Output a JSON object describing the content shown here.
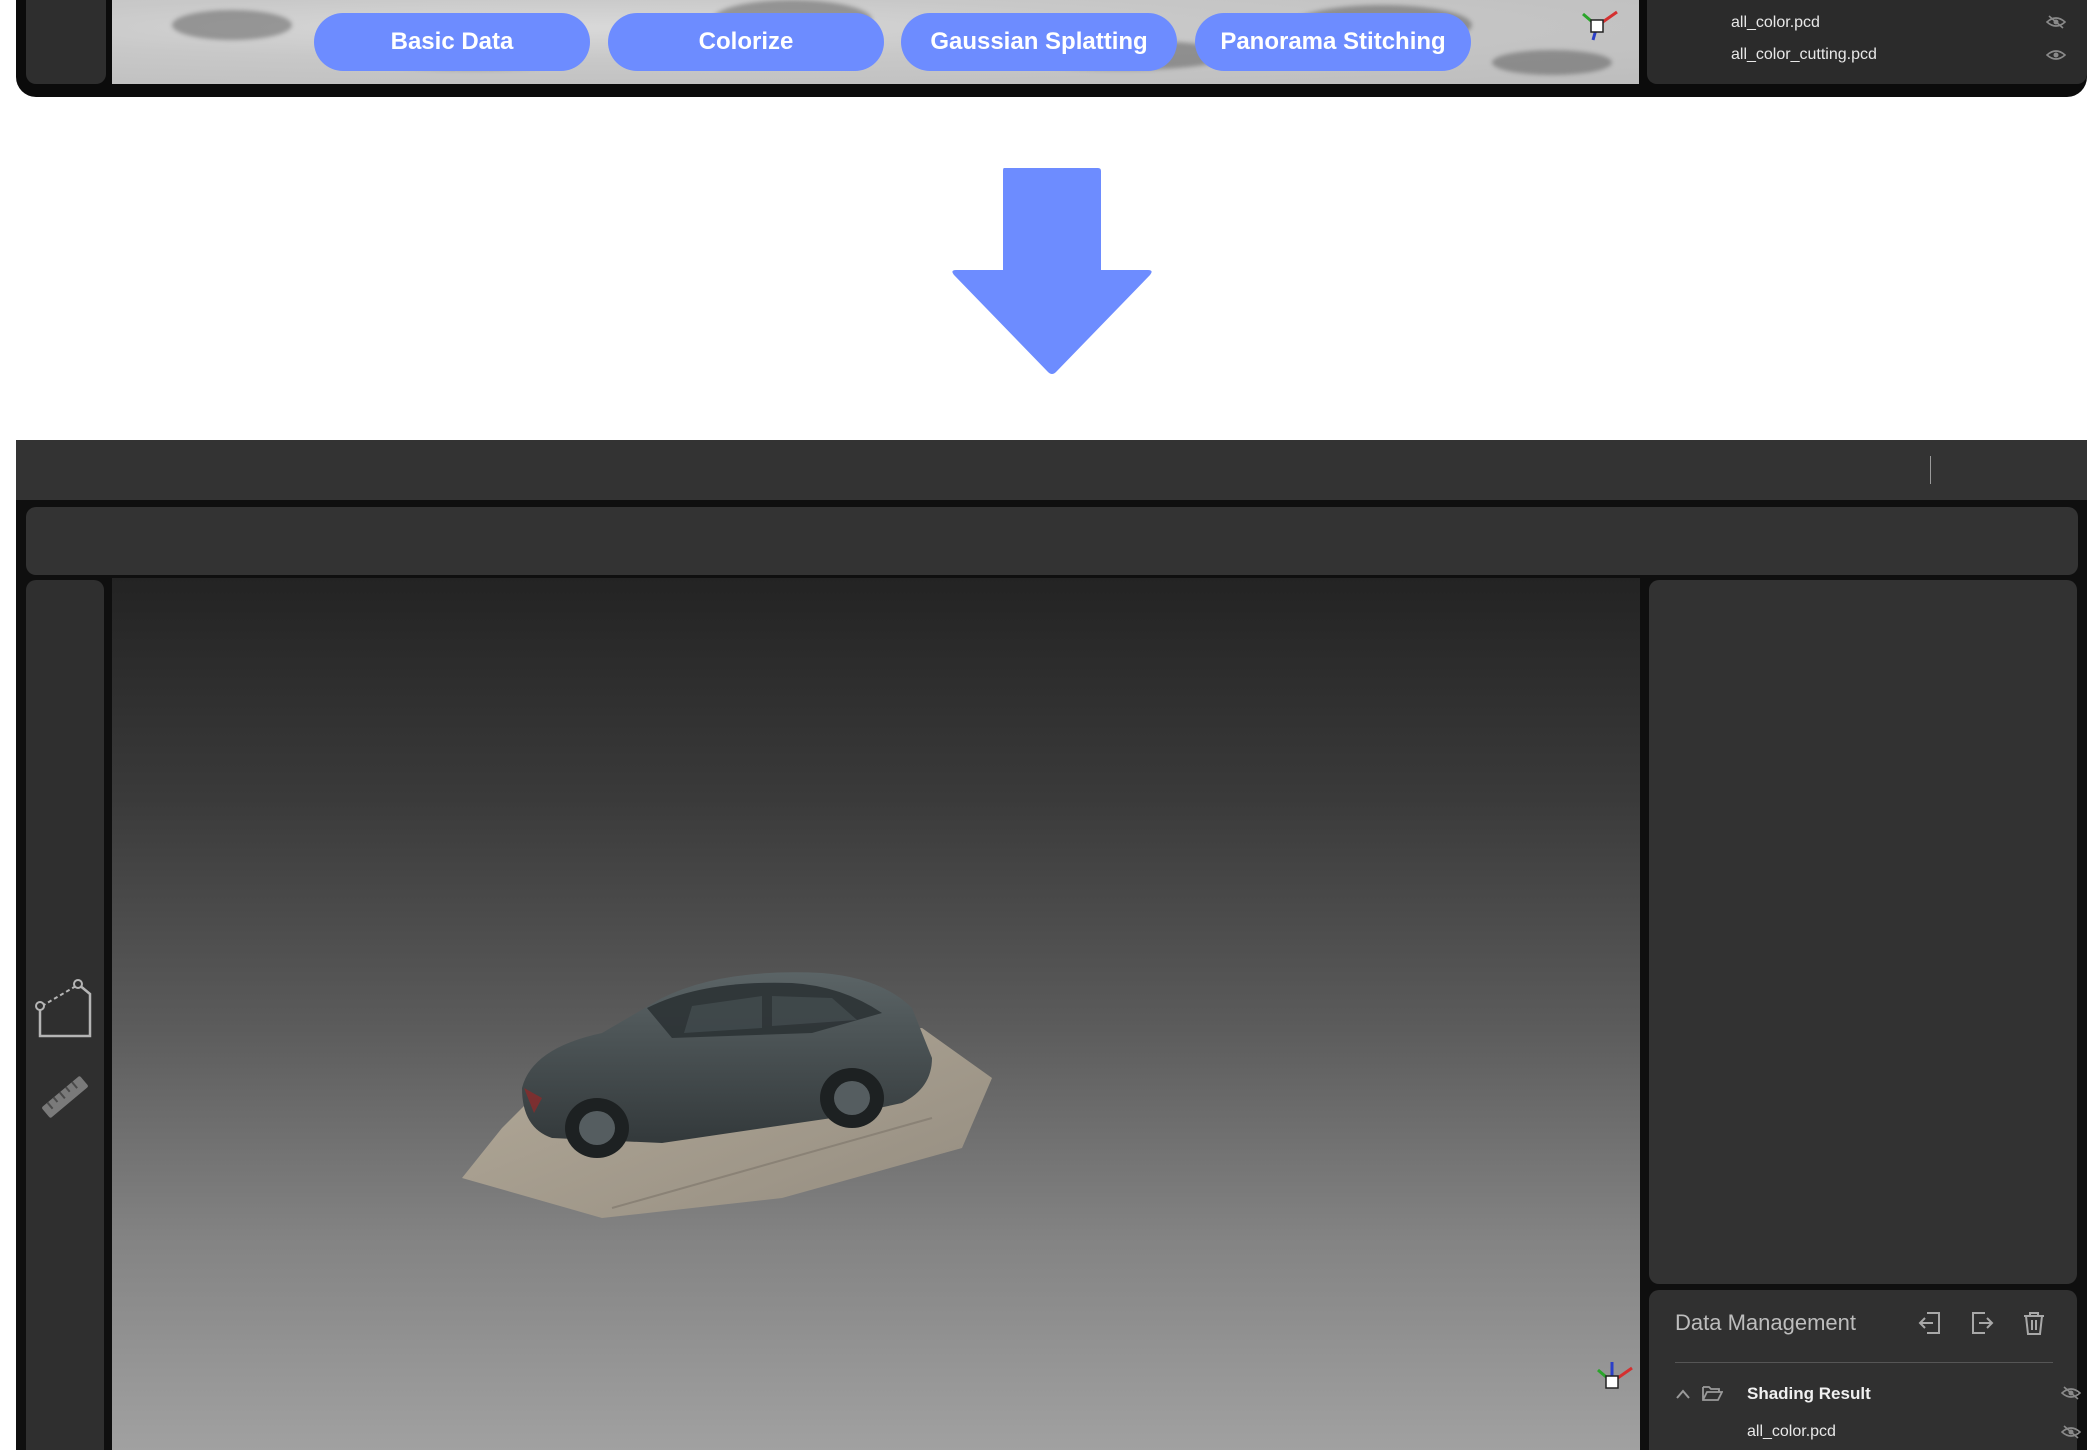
{
  "top_screenshot": {
    "mode_buttons": [
      "Basic Data",
      "Colorize",
      "Gaussian Splatting",
      "Panorama Stitching"
    ],
    "files": [
      {
        "name": "all_color.pcd",
        "visibility_icon": "eye-off-icon"
      },
      {
        "name": "all_color_cutting.pcd",
        "visibility_icon": "eye-icon"
      }
    ]
  },
  "arrow": {
    "icon": "arrow-down-icon",
    "color": "#6d8cff"
  },
  "bottom_screenshot": {
    "data_management": {
      "title": "Data Management",
      "actions": [
        "import-icon",
        "export-icon",
        "trash-icon"
      ],
      "folder": {
        "name": "Shading Result",
        "icon": "folder-open-icon",
        "expanded": true
      },
      "files": [
        {
          "name": "all_color.pcd",
          "visibility_icon": "eye-off-icon"
        }
      ]
    },
    "left_tools": [
      "polygon-select-icon",
      "ruler-icon"
    ],
    "viewport": {
      "content": "car-point-cloud"
    },
    "mode_button_count": 4
  },
  "colors": {
    "accent": "#6d8cff",
    "panel": "#333333",
    "background_dark": "#0f0f0f"
  }
}
